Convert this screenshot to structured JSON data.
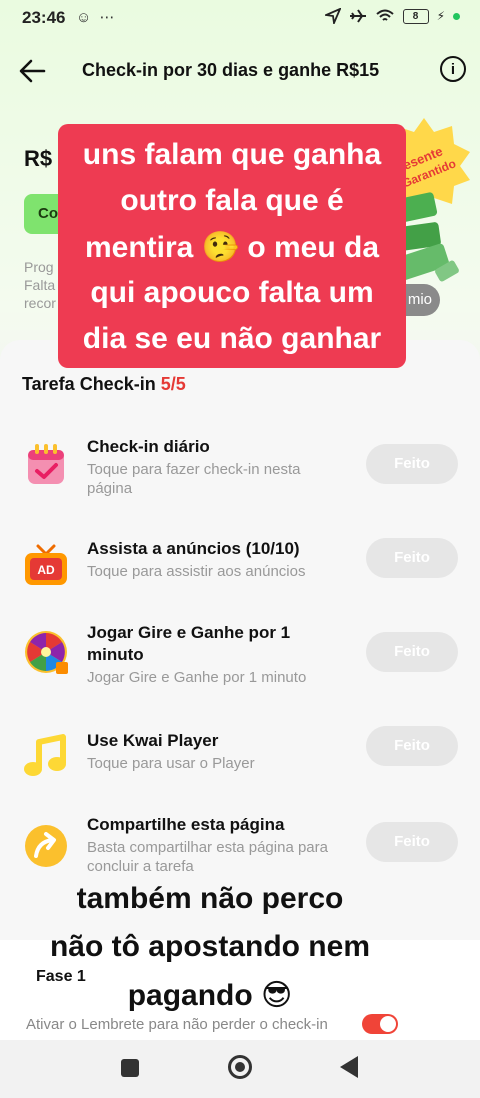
{
  "status_bar": {
    "time": "23:46",
    "left_icons": "☺ ⋯",
    "battery": "8"
  },
  "header": {
    "title": "Check-in por 30 dias e ganhe R$15",
    "info": "i"
  },
  "hero": {
    "amount": "R$",
    "button_label": "Co",
    "progress_line1": "Prog",
    "progress_line2": "Falta",
    "progress_line3": "recor",
    "pill_label": "mio",
    "badge_line1": "esente",
    "badge_line2": "Garantido"
  },
  "tasks_section": {
    "title": "Tarefa Check-in",
    "count": "5/5"
  },
  "tasks": [
    {
      "name": "Check-in diário",
      "desc": "Toque para fazer check-in nesta página",
      "button": "Feito"
    },
    {
      "name": "Assista a anúncios  (10/10)",
      "desc": "Toque para assistir aos anúncios",
      "button": "Feito"
    },
    {
      "name": "Jogar Gire e Ganhe por 1 minuto",
      "desc": "Jogar Gire e Ganhe por 1 minuto",
      "button": "Feito"
    },
    {
      "name": "Use Kwai Player",
      "desc": "Toque para usar o Player",
      "button": "Feito"
    },
    {
      "name": "Compartilhe esta página",
      "desc": "Basta compartilhar esta página para concluir a tarefa",
      "button": "Feito"
    }
  ],
  "phase": {
    "label": "Fase 1",
    "reminder": "Ativar o Lembrete para não perder o check-in"
  },
  "overlay_top": [
    "uns falam que ganha",
    "outro fala que é",
    "mentira 🤥 o meu da",
    "qui apouco falta um",
    "dia se eu não ganhar"
  ],
  "overlay_bottom": [
    "também não perco",
    "não tô apostando nem",
    "pagando 😎"
  ],
  "colors": {
    "accent_red": "#e53935",
    "overlay_red": "#ee3b52",
    "hero_green": "#7fe36e"
  }
}
